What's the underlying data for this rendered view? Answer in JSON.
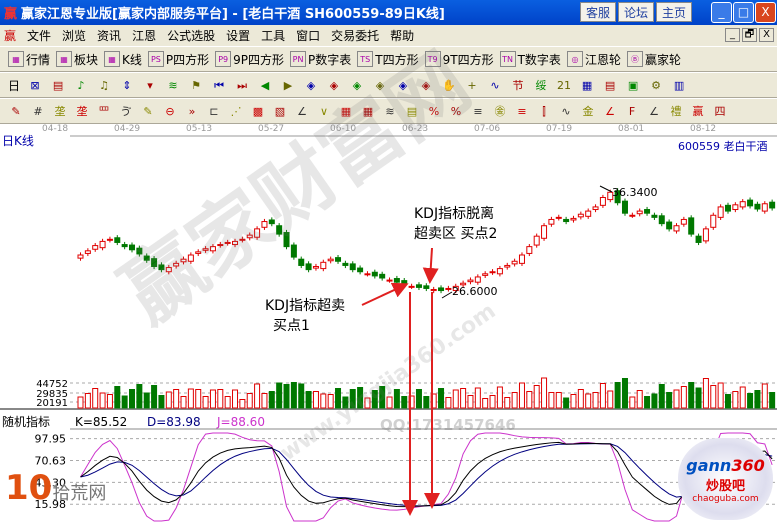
{
  "title": {
    "logo": "赢",
    "text": "赢家江恩专业版[赢家内部服务平台] - [老白干酒   SH600559-89日K线]",
    "buttons": [
      "客服",
      "论坛",
      "主页"
    ]
  },
  "window_controls": [
    "_",
    "□",
    "X"
  ],
  "mdi_controls": [
    "_",
    "🗗",
    "X"
  ],
  "menu": {
    "logo": "赢",
    "items": [
      "文件",
      "浏览",
      "资讯",
      "江恩",
      "公式选股",
      "设置",
      "工具",
      "窗口",
      "交易委托",
      "帮助"
    ]
  },
  "toolbar1": [
    {
      "icon": "grid-icon",
      "label": "行情"
    },
    {
      "icon": "blocks-icon",
      "label": "板块"
    },
    {
      "icon": "candles-icon",
      "label": "K线"
    },
    {
      "icon": "ps-icon",
      "glyph": "PS",
      "label": "P四方形"
    },
    {
      "icon": "p9-icon",
      "glyph": "P9",
      "label": "9P四方形"
    },
    {
      "icon": "pn-icon",
      "glyph": "PN",
      "label": "P数字表"
    },
    {
      "icon": "ts-icon",
      "glyph": "TS",
      "label": "T四方形"
    },
    {
      "icon": "t9-icon",
      "glyph": "T9",
      "label": "9T四方形"
    },
    {
      "icon": "tn-icon",
      "glyph": "TN",
      "label": "T数字表"
    },
    {
      "icon": "gann-wheel-icon",
      "glyph": "◎",
      "label": "江恩轮"
    },
    {
      "icon": "big-wheel-icon",
      "glyph": "Ⓑ",
      "label": "赢家轮"
    }
  ],
  "toolbar2": {
    "period": "日",
    "glyphs": [
      "⊠",
      "▤",
      "♪",
      "♫",
      "⇕",
      "▾",
      "≋",
      "⚑",
      "⏮",
      "⏭",
      "◀",
      "▶",
      "◈",
      "◈",
      "◈",
      "◈",
      "◈",
      "◈",
      "✋",
      "+",
      "∿",
      "节",
      "绥",
      "21",
      "▦",
      "▤",
      "▣",
      "⚙",
      "▥"
    ]
  },
  "toolbar3": {
    "glyphs": [
      "✎",
      "#",
      "垄",
      "垄",
      "罒",
      "ゔ",
      "✎",
      "⊖",
      "»",
      "⊏",
      "⋰",
      "▩",
      "▧",
      "∠",
      "∨",
      "▦",
      "▦",
      "≋",
      "▤",
      "%",
      "%",
      "≡",
      "㊎",
      "≡",
      "⫿",
      "∿",
      "金",
      "∠",
      "F",
      "∠",
      "禮",
      "赢",
      "四"
    ]
  },
  "dates": [
    "04-18",
    "04-29",
    "05-13",
    "05-27",
    "06-10",
    "06-23",
    "07-06",
    "07-19",
    "08-01",
    "08-12"
  ],
  "chart": {
    "period_label": "日K线",
    "stock": "600559  老白干酒",
    "high_label": "36.3400",
    "low_label": "26.6000",
    "closes": [
      30.0,
      30.4,
      30.9,
      31.3,
      31.5,
      31.2,
      30.8,
      30.5,
      30.1,
      29.5,
      28.9,
      28.6,
      28.8,
      29.2,
      29.6,
      30.0,
      30.3,
      30.6,
      30.8,
      31.0,
      31.2,
      31.3,
      31.5,
      31.9,
      32.5,
      33.2,
      33.0,
      32.0,
      30.8,
      29.8,
      29.0,
      28.6,
      28.9,
      29.3,
      29.6,
      29.4,
      29.0,
      28.6,
      28.4,
      28.2,
      28.0,
      27.8,
      27.6,
      27.4,
      27.2,
      27.0,
      26.9,
      26.8,
      26.7,
      26.6,
      26.8,
      27.0,
      27.3,
      27.6,
      27.9,
      28.2,
      28.4,
      28.7,
      29.0,
      29.4,
      30.0,
      30.8,
      31.8,
      32.8,
      33.4,
      33.6,
      33.2,
      33.5,
      33.9,
      34.2,
      34.6,
      35.5,
      36.0,
      35.0,
      34.0,
      33.8,
      34.2,
      34.0,
      33.6,
      33.0,
      32.5,
      32.8,
      33.4,
      32.0,
      31.2,
      32.5,
      33.8,
      34.6,
      34.2,
      34.8,
      35.1,
      34.7,
      34.4,
      34.9,
      34.5
    ],
    "price_range": [
      19,
      41
    ],
    "up_color": "#e00000",
    "down_color": "#007800"
  },
  "volume": {
    "ticks": [
      "44752",
      "29835",
      "20191"
    ]
  },
  "kdj": {
    "title": "随机指标",
    "k": "K=85.52",
    "d": "D=83.98",
    "j": "J=88.60",
    "ticks": [
      "97.95",
      "70.63",
      "43.30",
      "15.98"
    ],
    "k_color": "#000000",
    "d_color": "#000080",
    "j_color": "#cc33cc"
  },
  "annotations": {
    "buy2": [
      "KDJ指标脱离",
      "超卖区  买点2"
    ],
    "buy1": [
      "KDJ指标超卖",
      "买点1"
    ]
  },
  "watermarks": {
    "main": "赢家财富网",
    "url": "www.yingjia360.com",
    "qq": "QQ:1731457646",
    "logo_left": "10 拾荒网 Fhuang.CN",
    "logo_right": "gann360 炒股吧 chaoguba.com"
  }
}
